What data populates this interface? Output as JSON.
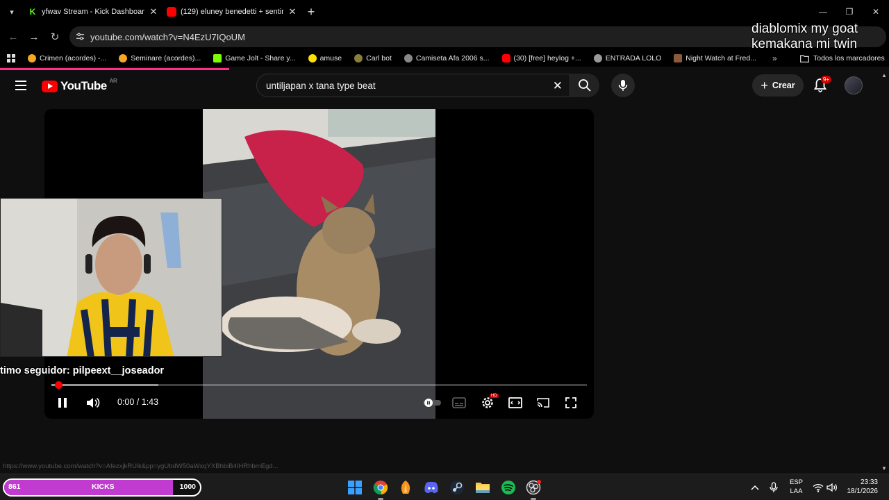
{
  "browser": {
    "tabs": [
      {
        "title": "yfwav Stream - Kick Dashboard",
        "favicon_color": "#53fc18"
      },
      {
        "title": "(129) eluney benedetti + sentin",
        "favicon_color": "#ff0000"
      }
    ],
    "url": "youtube.com/watch?v=N4EzU7IQoUM",
    "bookmarks": [
      {
        "label": "Crimen (acordes) -...",
        "color": "#f5a623"
      },
      {
        "label": "Seminare (acordes)...",
        "color": "#f5a623"
      },
      {
        "label": "Game Jolt - Share y...",
        "color": "#7cfc00"
      },
      {
        "label": "amuse",
        "color": "#ffe000"
      },
      {
        "label": "Carl bot",
        "color": "#8b7d3a"
      },
      {
        "label": "Camiseta Afa 2006 s...",
        "color": "#888888"
      },
      {
        "label": "(30) [free] heylog +...",
        "color": "#ff0000"
      },
      {
        "label": "ENTRADA LOLO",
        "color": "#999999"
      },
      {
        "label": "Night Watch at Fred...",
        "color": "#8a5a3a"
      }
    ],
    "bookmarks_more": "»",
    "all_bookmarks": "Todos los marcadores",
    "status_url": "https://www.youtube.com/watch?v=AfezxjkRUik&pp=ygUbdW50aWxqYXBhbiB4IHRhbmEgd..."
  },
  "overlay": {
    "line1": "diablomix my goat",
    "line2": "kemakana mi twin",
    "follower": "timo seguidor: pilpeext__joseador"
  },
  "youtube": {
    "logo": "YouTube",
    "country": "AR",
    "search_query": "untiljapan x tana type beat",
    "create_label": "Crear",
    "notifications_badge": "9+"
  },
  "player": {
    "time": "0:00 / 1:43",
    "progress_fraction": 0.0,
    "buffer_fraction": 0.2,
    "settings_badge": "HD"
  },
  "taskbar": {
    "kicks_left": "861",
    "kicks_label": "KICKS",
    "kicks_right": "1000",
    "kicks_fill_fraction": 0.861,
    "lang_line1": "ESP",
    "lang_line2": "LAA",
    "time": "23:33",
    "date": "18/1/2026"
  }
}
